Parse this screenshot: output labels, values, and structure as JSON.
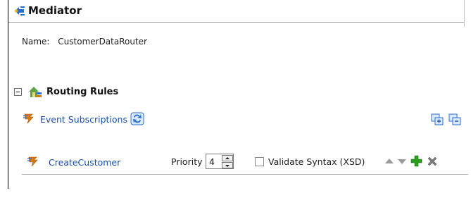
{
  "header": {
    "title": "Mediator",
    "icon": "mediator-icon"
  },
  "properties": {
    "name_label": "Name:",
    "name_value": "CustomerDataRouter"
  },
  "routing": {
    "section_title": "Routing Rules",
    "collapsed": false,
    "icon": "routing-rules-icon",
    "event_subscriptions_label": "Event Subscriptions",
    "rules": [
      {
        "name": "CreateCustomer",
        "priority_label": "Priority",
        "priority": "4",
        "validate_label": "Validate Syntax (XSD)",
        "validate_checked": false
      }
    ]
  },
  "colors": {
    "link": "#1b4ea8",
    "lightning": "#e07a12",
    "add": "#2d9d1f",
    "delete": "#7a7a7a"
  }
}
